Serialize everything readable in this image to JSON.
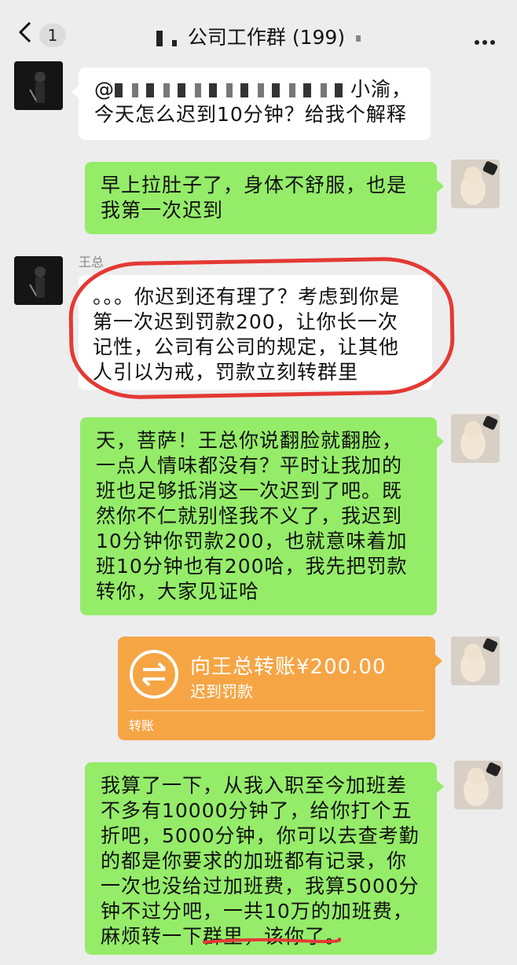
{
  "header": {
    "back_count": "1",
    "title": "公司工作群 (199)"
  },
  "messages": [
    {
      "line1_prefix": "@",
      "line1_suffix": "小渝，",
      "line2": "今天怎么迟到10分钟？给我个解释"
    },
    {
      "text": "早上拉肚子了，身体不舒服，也是我第一次迟到"
    },
    {
      "sender": "王总",
      "text": "。。。你迟到还有理了？考虑到你是第一次迟到罚款200，让你长一次记性，公司有公司的规定，让其他人引以为戒，罚款立刻转群里"
    },
    {
      "text": "天，菩萨！王总你说翻脸就翻脸，一点人情味都没有？平时让我加的班也足够抵消这一次迟到了吧。既然你不仁就别怪我不义了，我迟到10分钟你罚款200，也就意味着加班10分钟也有200哈，我先把罚款转你，大家见证哈"
    },
    {
      "text": "我算了一下，从我入职至今加班差不多有10000分钟了，给你打个五折吧，5000分钟，你可以去查考勤的都是你要求的加班都有记录，你一次也没给过加班费，我算5000分钟不过分吧，一共10万的加班费，麻烦转一下群里，该你了。"
    }
  ],
  "transfer": {
    "amount_label": "向王总转账¥200.00",
    "memo": "迟到罚款",
    "type_label": "转账"
  },
  "colors": {
    "bubble_green": "#95ec69",
    "bubble_white": "#ffffff",
    "transfer_orange": "#f6a545",
    "highlight_red": "#e53935"
  }
}
